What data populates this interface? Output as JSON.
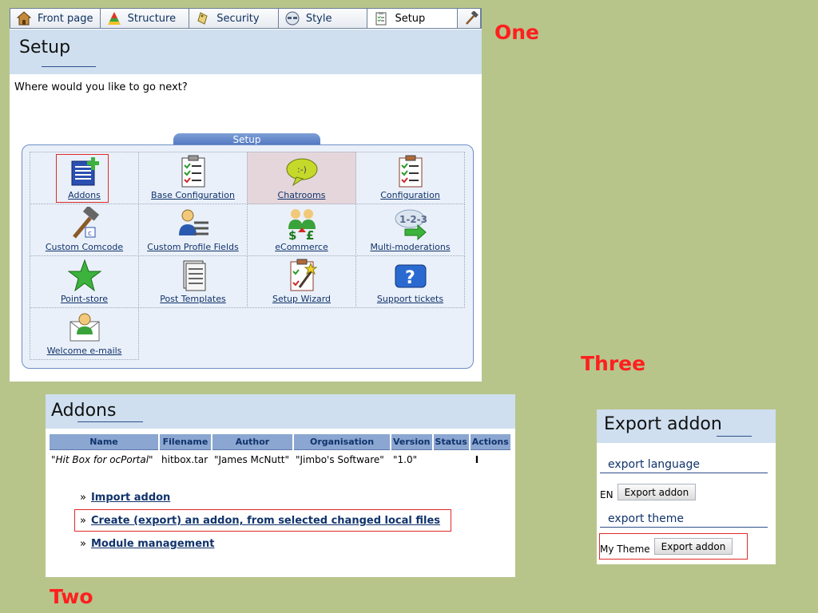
{
  "tabs": [
    {
      "label": "Front page",
      "icon": "house-icon"
    },
    {
      "label": "Structure",
      "icon": "pyramid-icon"
    },
    {
      "label": "Security",
      "icon": "tag-icon"
    },
    {
      "label": "Style",
      "icon": "glasses-icon"
    },
    {
      "label": "Setup",
      "icon": "clipboard-icon",
      "active": true
    },
    {
      "label": "",
      "icon": "hammer-icon"
    }
  ],
  "one": {
    "title": "Setup",
    "prompt": "Where would you like to go next?",
    "box_label": "Setup",
    "items": [
      {
        "label": "Addons",
        "icon": "addons-icon"
      },
      {
        "label": "Base Configuration",
        "icon": "checklist-icon"
      },
      {
        "label": "Chatrooms",
        "icon": "chat-bubble-icon"
      },
      {
        "label": "Configuration",
        "icon": "checklist-icon"
      },
      {
        "label": "Custom Comcode",
        "icon": "hammer-icon"
      },
      {
        "label": "Custom Profile Fields",
        "icon": "user-fields-icon"
      },
      {
        "label": "eCommerce",
        "icon": "money-icon"
      },
      {
        "label": "Multi-moderations",
        "icon": "steps-arrow-icon"
      },
      {
        "label": "Point-store",
        "icon": "star-icon"
      },
      {
        "label": "Post Templates",
        "icon": "document-stack-icon"
      },
      {
        "label": "Setup Wizard",
        "icon": "wizard-icon"
      },
      {
        "label": "Support tickets",
        "icon": "question-icon"
      },
      {
        "label": "Welcome e-mails",
        "icon": "envelope-user-icon"
      }
    ]
  },
  "labels": {
    "one": "One",
    "two": "Two",
    "three": "Three"
  },
  "two": {
    "title": "Addons",
    "columns": [
      "Name",
      "Filename",
      "Author",
      "Organisation",
      "Version",
      "Status",
      "Actions"
    ],
    "row": {
      "name": "\"Hit Box for ocPortal\"",
      "filename": "hitbox.tar",
      "author": "\"James McNutt\"",
      "organisation": "\"Jimbo's Software\"",
      "version": "\"1.0\"",
      "status": "",
      "actions": "I"
    },
    "links": [
      "Import addon",
      "Create (export) an addon, from selected changed local files",
      "Module management"
    ],
    "raquo": "»"
  },
  "three": {
    "title": "Export addon",
    "lang_heading": "export language",
    "lang_code": "EN",
    "theme_heading": "export theme",
    "theme_name": "My Theme",
    "button_label": "Export addon"
  },
  "colors": {
    "background": "#b7c58b",
    "title_bar": "#cfdfef",
    "link": "#10336b",
    "label_red": "#ff1f1f",
    "highlight_box": "#e02a2a"
  }
}
